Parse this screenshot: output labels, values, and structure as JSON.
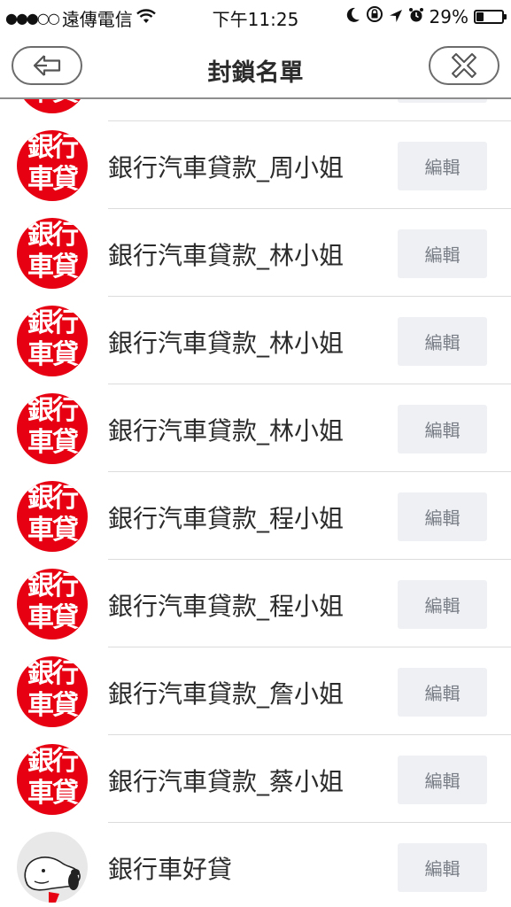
{
  "status_bar": {
    "signal": "●●●○○",
    "carrier": "遠傳電信",
    "time": "下午11:25",
    "battery_text": "29%",
    "battery_level": 0.29
  },
  "nav": {
    "title": "封鎖名單",
    "back_icon": "back-arrow-icon",
    "close_icon": "close-icon"
  },
  "avatar_text": [
    "銀行",
    "車貸"
  ],
  "edit_label": "編輯",
  "contacts": [
    {
      "name": "",
      "avatar": "bank-car-loan-logo"
    },
    {
      "name": "銀行汽車貸款_周小姐",
      "avatar": "bank-car-loan-logo"
    },
    {
      "name": "銀行汽車貸款_林小姐",
      "avatar": "bank-car-loan-logo"
    },
    {
      "name": "銀行汽車貸款_林小姐",
      "avatar": "bank-car-loan-logo"
    },
    {
      "name": "銀行汽車貸款_林小姐",
      "avatar": "bank-car-loan-logo"
    },
    {
      "name": "銀行汽車貸款_程小姐",
      "avatar": "bank-car-loan-logo"
    },
    {
      "name": "銀行汽車貸款_程小姐",
      "avatar": "bank-car-loan-logo"
    },
    {
      "name": "銀行汽車貸款_詹小姐",
      "avatar": "bank-car-loan-logo"
    },
    {
      "name": "銀行汽車貸款_蔡小姐",
      "avatar": "bank-car-loan-logo"
    },
    {
      "name": "銀行車好貸",
      "avatar": "snoopy-avatar"
    }
  ]
}
